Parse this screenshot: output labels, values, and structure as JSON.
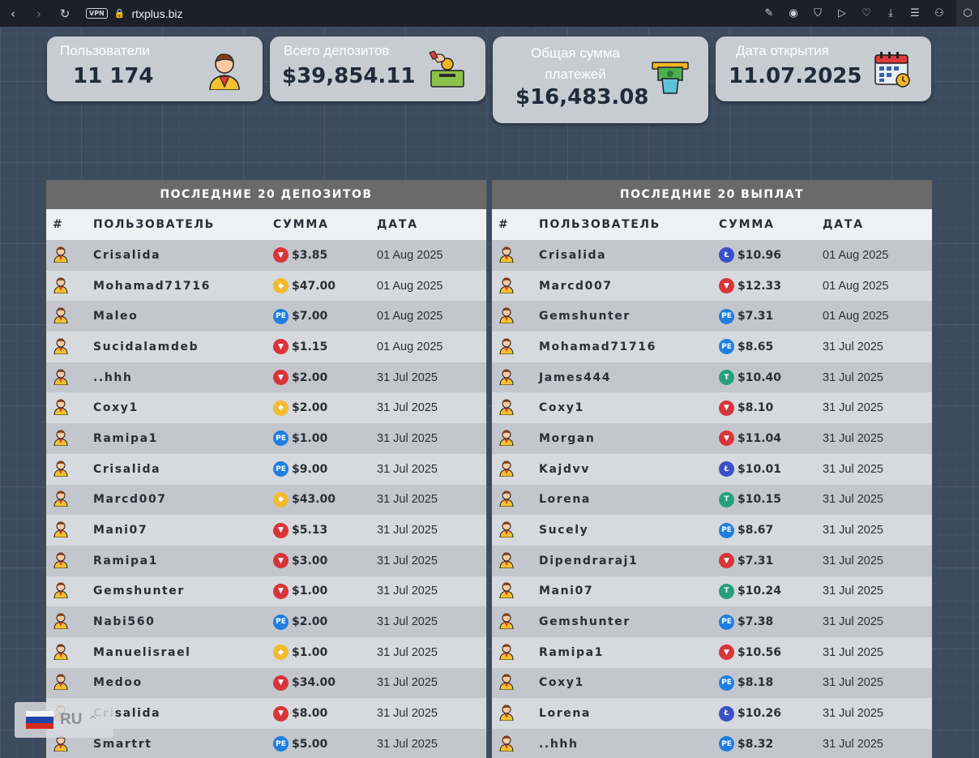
{
  "browser": {
    "vpn": "VPN",
    "url": "rtxplus.biz"
  },
  "stats": [
    {
      "label": "Пользователи",
      "value": "11 174",
      "icon": "user-icon"
    },
    {
      "label": "Всего депозитов",
      "value": "$39,854.11",
      "icon": "deposit-icon"
    },
    {
      "label": "Общая сумма платежей",
      "value": "$16,483.08",
      "icon": "cash-withdraw-icon"
    },
    {
      "label": "Дата открытия",
      "value": "11.07.2025",
      "icon": "calendar-icon"
    }
  ],
  "deposits": {
    "title": "ПОСЛЕДНИЕ 20 ДЕПОЗИТОВ",
    "headers": [
      "#",
      "ПОЛЬЗОВАТЕЛЬ",
      "СУММА",
      "ДАТА"
    ],
    "rows": [
      {
        "user": "Crisalida",
        "coin": "trx",
        "amount": "$3.85",
        "date": "01 Aug 2025"
      },
      {
        "user": "Mohamad71716",
        "coin": "bnb",
        "amount": "$47.00",
        "date": "01 Aug 2025"
      },
      {
        "user": "Maleo",
        "coin": "pe",
        "amount": "$7.00",
        "date": "01 Aug 2025"
      },
      {
        "user": "Sucidalamdeb",
        "coin": "trx",
        "amount": "$1.15",
        "date": "01 Aug 2025"
      },
      {
        "user": "..hhh",
        "coin": "trx",
        "amount": "$2.00",
        "date": "31 Jul 2025"
      },
      {
        "user": "Coxy1",
        "coin": "bnb",
        "amount": "$2.00",
        "date": "31 Jul 2025"
      },
      {
        "user": "Ramipa1",
        "coin": "pe",
        "amount": "$1.00",
        "date": "31 Jul 2025"
      },
      {
        "user": "Crisalida",
        "coin": "pe",
        "amount": "$9.00",
        "date": "31 Jul 2025"
      },
      {
        "user": "Marcd007",
        "coin": "bnb",
        "amount": "$43.00",
        "date": "31 Jul 2025"
      },
      {
        "user": "Mani07",
        "coin": "trx",
        "amount": "$5.13",
        "date": "31 Jul 2025"
      },
      {
        "user": "Ramipa1",
        "coin": "trx",
        "amount": "$3.00",
        "date": "31 Jul 2025"
      },
      {
        "user": "Gemshunter",
        "coin": "trx",
        "amount": "$1.00",
        "date": "31 Jul 2025"
      },
      {
        "user": "Nabi560",
        "coin": "pe",
        "amount": "$2.00",
        "date": "31 Jul 2025"
      },
      {
        "user": "Manuelisrael",
        "coin": "bnb",
        "amount": "$1.00",
        "date": "31 Jul 2025"
      },
      {
        "user": "Medoo",
        "coin": "trx",
        "amount": "$34.00",
        "date": "31 Jul 2025"
      },
      {
        "user": "Crisalida",
        "coin": "trx",
        "amount": "$8.00",
        "date": "31 Jul 2025"
      },
      {
        "user": "Smartrt",
        "coin": "pe",
        "amount": "$5.00",
        "date": "31 Jul 2025"
      }
    ]
  },
  "payouts": {
    "title": "ПОСЛЕДНИЕ 20 ВЫПЛАТ",
    "headers": [
      "#",
      "ПОЛЬЗОВАТЕЛЬ",
      "СУММА",
      "ДАТА"
    ],
    "rows": [
      {
        "user": "Crisalida",
        "coin": "ltc",
        "amount": "$10.96",
        "date": "01 Aug 2025"
      },
      {
        "user": "Marcd007",
        "coin": "trx",
        "amount": "$12.33",
        "date": "01 Aug 2025"
      },
      {
        "user": "Gemshunter",
        "coin": "pe",
        "amount": "$7.31",
        "date": "01 Aug 2025"
      },
      {
        "user": "Mohamad71716",
        "coin": "pe",
        "amount": "$8.65",
        "date": "31 Jul 2025"
      },
      {
        "user": "James444",
        "coin": "usdt",
        "amount": "$10.40",
        "date": "31 Jul 2025"
      },
      {
        "user": "Coxy1",
        "coin": "trx",
        "amount": "$8.10",
        "date": "31 Jul 2025"
      },
      {
        "user": "Morgan",
        "coin": "trx",
        "amount": "$11.04",
        "date": "31 Jul 2025"
      },
      {
        "user": "Kajdvv",
        "coin": "ltc",
        "amount": "$10.01",
        "date": "31 Jul 2025"
      },
      {
        "user": "Lorena",
        "coin": "usdt",
        "amount": "$10.15",
        "date": "31 Jul 2025"
      },
      {
        "user": "Sucely",
        "coin": "pe",
        "amount": "$8.67",
        "date": "31 Jul 2025"
      },
      {
        "user": "Dipendraraj1",
        "coin": "trx",
        "amount": "$7.31",
        "date": "31 Jul 2025"
      },
      {
        "user": "Mani07",
        "coin": "usdt",
        "amount": "$10.24",
        "date": "31 Jul 2025"
      },
      {
        "user": "Gemshunter",
        "coin": "pe",
        "amount": "$7.38",
        "date": "31 Jul 2025"
      },
      {
        "user": "Ramipa1",
        "coin": "trx",
        "amount": "$10.56",
        "date": "31 Jul 2025"
      },
      {
        "user": "Coxy1",
        "coin": "pe",
        "amount": "$8.18",
        "date": "31 Jul 2025"
      },
      {
        "user": "Lorena",
        "coin": "ltc",
        "amount": "$10.26",
        "date": "31 Jul 2025"
      },
      {
        "user": "..hhh",
        "coin": "pe",
        "amount": "$8.32",
        "date": "31 Jul 2025"
      }
    ]
  },
  "language": {
    "code": "RU"
  },
  "colors": {
    "trx": "#d9343a",
    "bnb": "#f3ba2f",
    "pe": "#1f7fe0",
    "ltc": "#3a50c8",
    "usdt": "#26a17b"
  }
}
